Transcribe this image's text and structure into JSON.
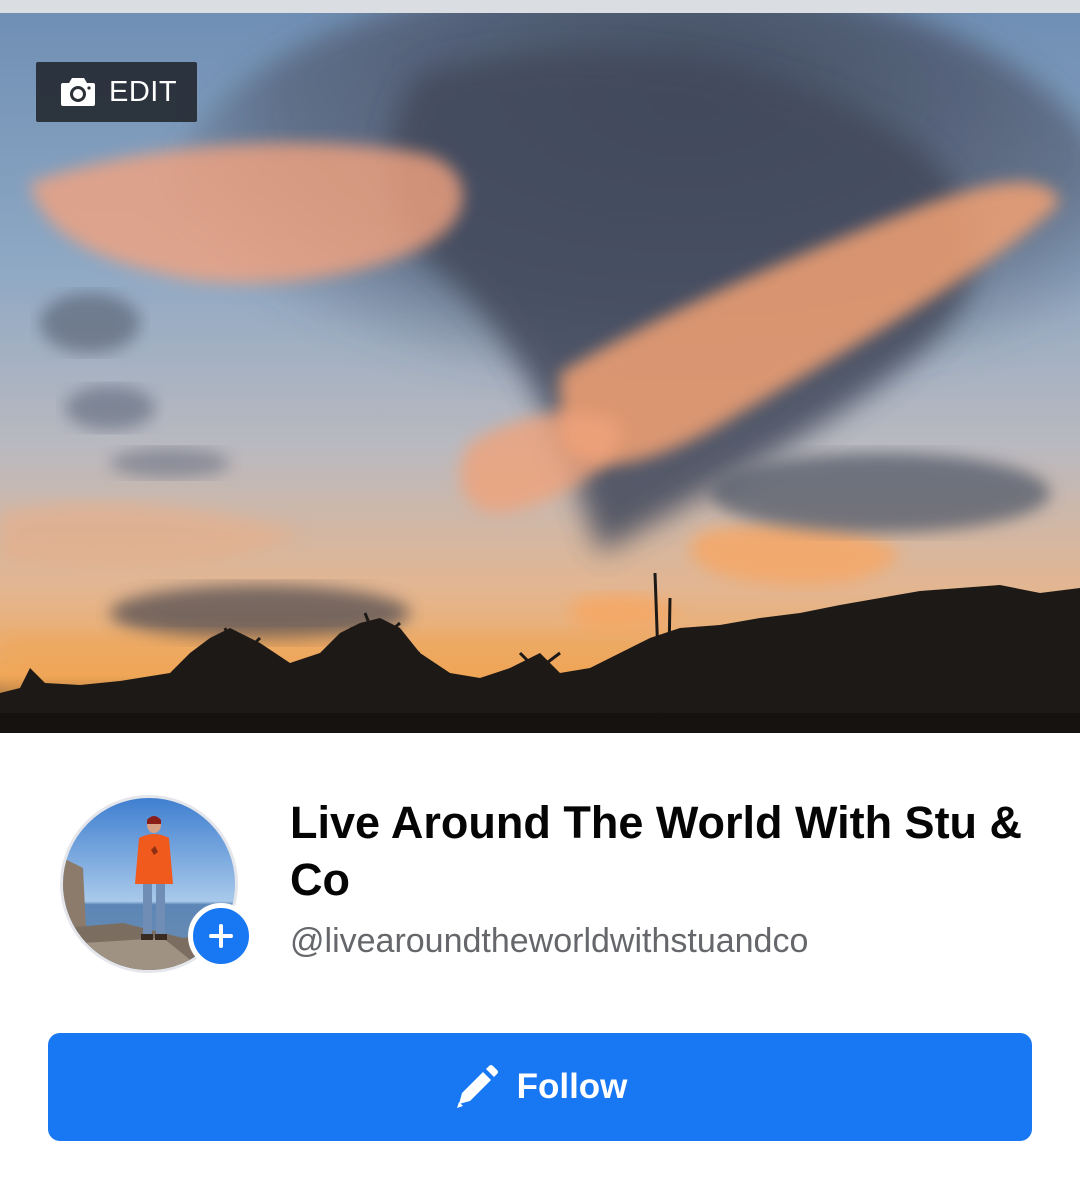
{
  "cover": {
    "edit_label": "EDIT",
    "icon": "camera-icon"
  },
  "profile": {
    "name": "Live Around The World With Stu & Co",
    "handle": "@livearoundtheworldwithstuandco",
    "add_photo_icon": "plus-icon"
  },
  "actions": {
    "follow_label": "Follow",
    "follow_icon": "pencil-icon"
  },
  "colors": {
    "accent": "#1877f2",
    "name_text": "#050505",
    "secondary_text": "#65676b"
  }
}
